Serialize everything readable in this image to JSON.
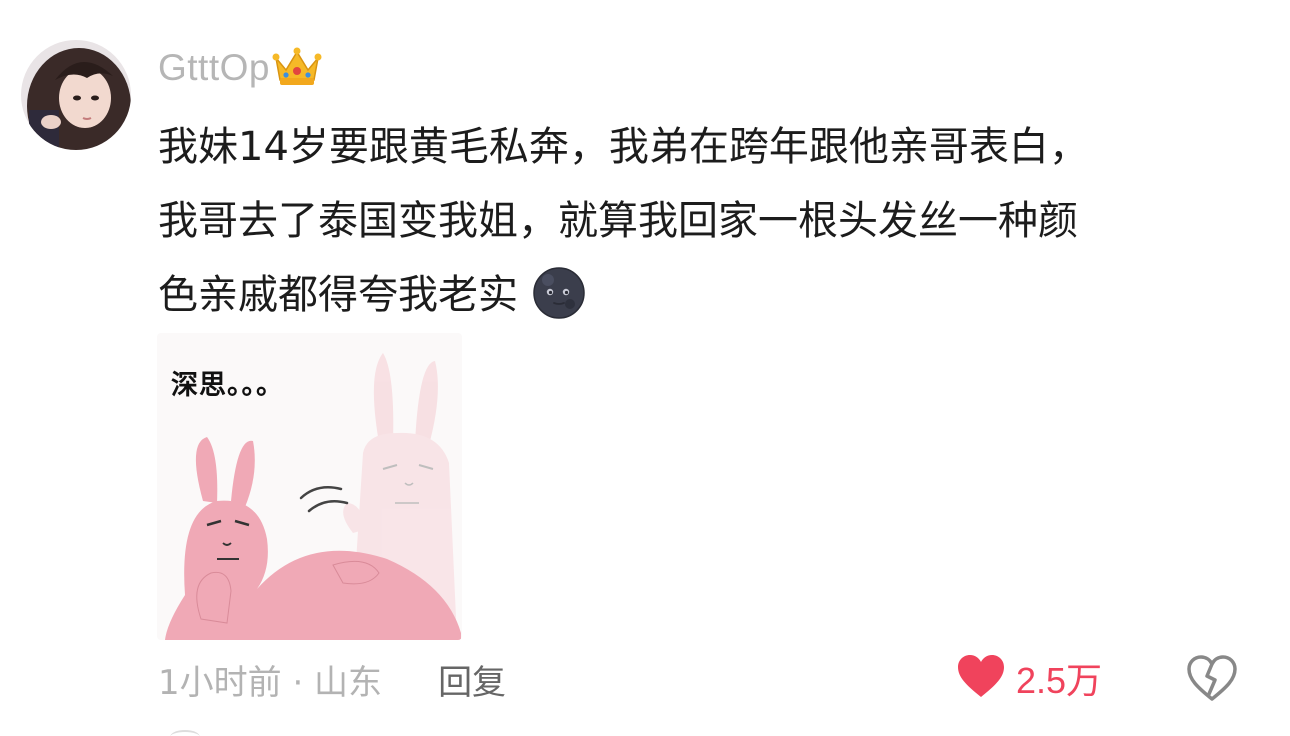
{
  "comment": {
    "username": "GtttOp",
    "badge_icon": "crown-icon",
    "text_lines": [
      "我妹14岁要跟黄毛私奔，我弟在跨年跟他亲哥表白，",
      "我哥去了泰国变我姐，就算我回家一根头发丝一种颜",
      "色亲戚都得夸我老实"
    ],
    "trailing_emoji": "new-moon-face-emoji",
    "image": {
      "caption": "深思。。。",
      "description_icon": "pink-rabbit-meme"
    },
    "meta": "1小时前 · 山东",
    "reply_label": "回复",
    "like_count": "2.5万",
    "liked": true,
    "colors": {
      "like": "#f0435c",
      "username": "#b6b6b6",
      "text": "#1c1c1c",
      "meta": "#b3b3b3"
    }
  }
}
